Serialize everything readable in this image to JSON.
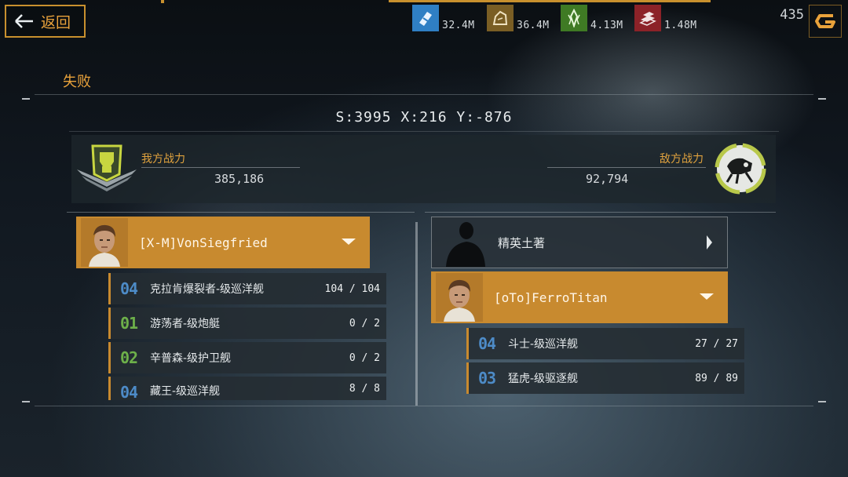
{
  "nav": {
    "back_label": "返回"
  },
  "resources": [
    {
      "icon": "crystal-shard-icon",
      "value": "32.4M",
      "color": "#2f7fc4"
    },
    {
      "icon": "ore-rock-icon",
      "value": "36.4M",
      "color": "#8a6a2a"
    },
    {
      "icon": "green-crystal-icon",
      "value": "4.13M",
      "color": "#4a8a2a"
    },
    {
      "icon": "alloy-bars-icon",
      "value": "1.48M",
      "color": "#9a2a30"
    }
  ],
  "gold": {
    "count": "435",
    "icon": "gold-g-icon"
  },
  "battle": {
    "result": "失败",
    "coords": "S:3995 X:216 Y:-876",
    "our_power_label": "我方战力",
    "our_power_value": "385,186",
    "enemy_power_label": "敌方战力",
    "enemy_power_value": "92,794"
  },
  "ally": {
    "player_name": "[X-M]VonSiegfried",
    "ships": [
      {
        "num": "04",
        "name": "克拉肯爆裂者-级巡洋舰",
        "count": "104 / 104",
        "num_color": "blue"
      },
      {
        "num": "01",
        "name": "游荡者-级炮艇",
        "count": "0 / 2",
        "num_color": "green"
      },
      {
        "num": "02",
        "name": "辛普森-级护卫舰",
        "count": "0 / 2",
        "num_color": "green"
      },
      {
        "num": "04",
        "name": "藏王-级巡洋舰",
        "count": "8 / 8",
        "num_color": "blue"
      }
    ]
  },
  "enemy": {
    "elite_label": "精英土著",
    "player_name": "[oTo]FerroTitan",
    "ships": [
      {
        "num": "04",
        "name": "斗士-级巡洋舰",
        "count": "27 / 27",
        "num_color": "blue"
      },
      {
        "num": "03",
        "name": "猛虎-级驱逐舰",
        "count": "89 / 89",
        "num_color": "blue"
      }
    ]
  }
}
